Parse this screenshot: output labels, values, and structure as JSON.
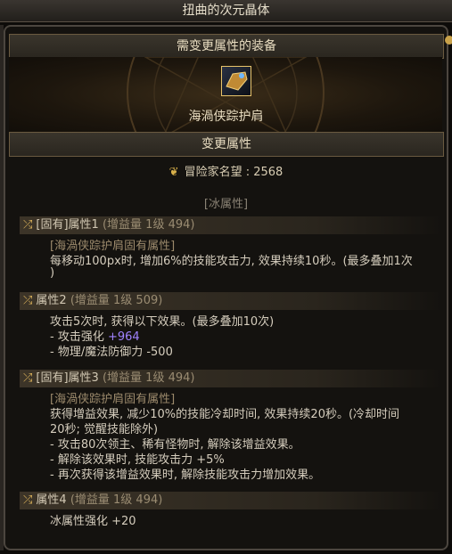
{
  "window": {
    "title": "扭曲的次元晶体"
  },
  "section_equipment": {
    "title": "需变更属性的装备"
  },
  "item": {
    "name": "海渦侠踪护肩"
  },
  "section_change": {
    "title": "变更属性"
  },
  "reputation": {
    "label": "冒险家名望 : 2568"
  },
  "element": {
    "label": "[冰属性]"
  },
  "attributes": [
    {
      "head": "[固有]属性1",
      "gain": "(增益量 1级 494)",
      "source": "[海渦侠踪护肩固有属性]",
      "lines": [
        "每移动100px时, 增加6%的技能攻击力, 效果持续10秒。(最多叠加1次",
        ")"
      ]
    },
    {
      "head": "属性2",
      "gain": "(增益量 1级 509)",
      "lines": [
        "攻击5次时, 获得以下效果。(最多叠加10次)",
        "- 攻击强化 ",
        "- 物理/魔法防御力 -500"
      ],
      "highlight": "+964"
    },
    {
      "head": "[固有]属性3",
      "gain": "(增益量 1级 494)",
      "source": "[海渦侠踪护肩固有属性]",
      "lines": [
        "获得增益效果, 减少10%的技能冷却时间, 效果持续20秒。(冷却时间",
        "20秒; 觉醒技能除外)",
        "- 攻击80次领主、稀有怪物时, 解除该增益效果。",
        "- 解除该效果时, 技能攻击力 +5%",
        "- 再次获得该增益效果时, 解除技能攻击力增加效果。"
      ]
    },
    {
      "head": "属性4",
      "gain": "(增益量 1级 494)",
      "lines": [
        "冰属性强化 +20"
      ]
    }
  ]
}
